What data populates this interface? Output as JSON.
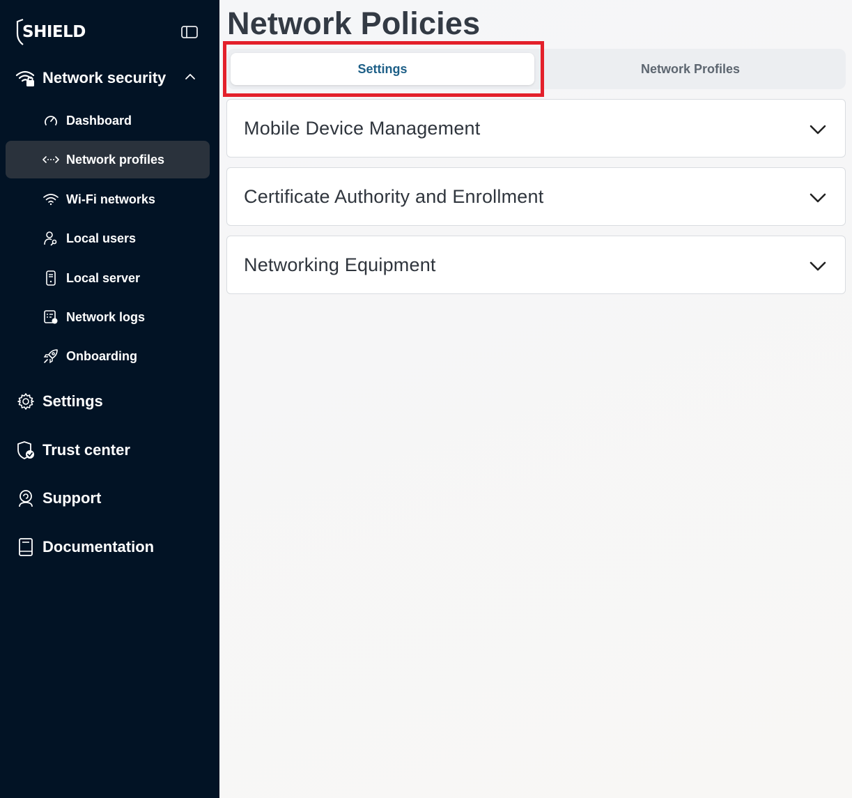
{
  "app": {
    "logo_text": "SHIELD"
  },
  "sidebar": {
    "section": {
      "label": "Network security",
      "icon": "wifi-lock-icon",
      "expanded": true
    },
    "sub_items": [
      {
        "label": "Dashboard",
        "icon": "speedometer-icon",
        "active": false
      },
      {
        "label": "Network profiles",
        "icon": "code-arrows-icon",
        "active": true
      },
      {
        "label": "Wi-Fi networks",
        "icon": "wifi-icon",
        "active": false
      },
      {
        "label": "Local users",
        "icon": "user-key-icon",
        "active": false
      },
      {
        "label": "Local server",
        "icon": "server-icon",
        "active": false
      },
      {
        "label": "Network logs",
        "icon": "log-icon",
        "active": false
      },
      {
        "label": "Onboarding",
        "icon": "rocket-icon",
        "active": false
      }
    ],
    "top_items": [
      {
        "label": "Settings",
        "icon": "gear-icon"
      },
      {
        "label": "Trust center",
        "icon": "shield-check-icon"
      },
      {
        "label": "Support",
        "icon": "headset-icon"
      },
      {
        "label": "Documentation",
        "icon": "book-icon"
      }
    ]
  },
  "main": {
    "title": "Network Policies",
    "tabs": [
      {
        "label": "Settings",
        "selected": true
      },
      {
        "label": "Network Profiles",
        "selected": false
      }
    ],
    "sections": [
      {
        "title": "Mobile Device Management",
        "expanded": false
      },
      {
        "title": "Certificate Authority and Enrollment",
        "expanded": false
      },
      {
        "title": "Networking Equipment",
        "expanded": false
      }
    ]
  },
  "colors": {
    "sidebar_bg": "#021325",
    "active_item_bg": "#2a323c",
    "selected_tab_text": "#1d5f87",
    "highlight_border": "#e3202b"
  }
}
